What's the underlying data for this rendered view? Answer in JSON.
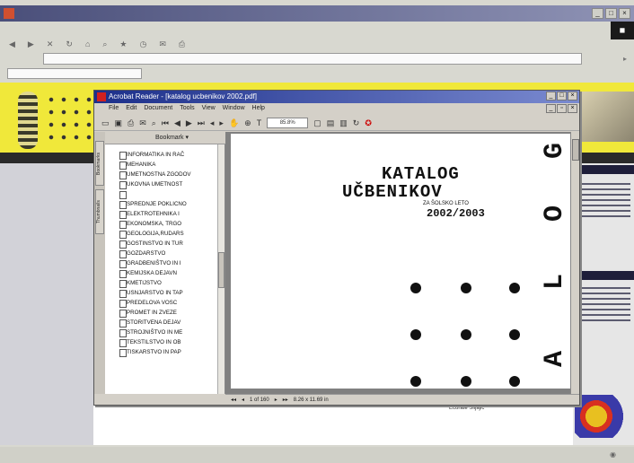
{
  "acrobat": {
    "title": "Acrobat Reader - [katalog ucbenikov 2002.pdf]",
    "menu": [
      "File",
      "Edit",
      "Document",
      "Tools",
      "View",
      "Window",
      "Help"
    ],
    "bookmarks_label": "Bookmark",
    "tabs": [
      "Bookmarks",
      "Thumbnails"
    ],
    "bookmarks": [
      "INFORMATIKA IN RAČ",
      "MEHANIKA",
      "UMETNOSTNA ZGODOV",
      "UKOVNA UMETNOST",
      "",
      "SPREDNJE POKLICNO",
      "ELEKTROTEHNIKA I",
      "EKONOMSKA, TRGO",
      "GEOLOGIJA,RUDARS",
      "GOSTINSTVO IN TUR",
      "GOZDARSTVO",
      "GRADBENIŠTVO IN I",
      "KEMIJSKA DEJAVN",
      "KMETIJSTVO",
      "USNJARSTVO IN TAP",
      "PREDELOVA VOSC",
      "PROMET IN ZVEZE",
      "STORITVENA DEJAV",
      "STROJNIŠTVO IN ME",
      "TEKSTILSTVO IN OB",
      "TISKARSTVO IN PAP"
    ],
    "zoom": "85.8%",
    "page_indicator": "1 of 160",
    "page_size": "8.26 x 11.69 in"
  },
  "pdf": {
    "title_line1": "KATALOG",
    "title_line2": "UČBENIKOV",
    "subtitle": "ZA ŠOLSKO LETO",
    "year": "2002/2003",
    "side_letters": [
      "G",
      "O",
      "L",
      "A"
    ]
  },
  "page_footer": "Ecorate Šiljajic"
}
